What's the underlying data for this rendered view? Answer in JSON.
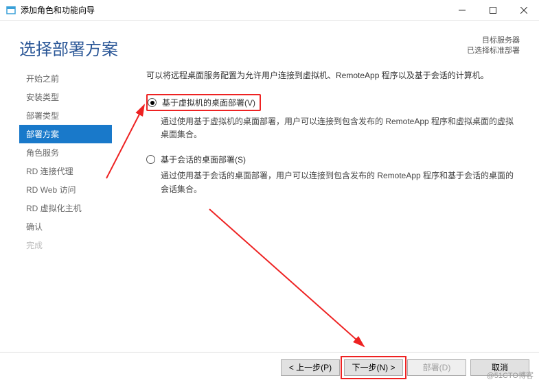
{
  "window": {
    "title": "添加角色和功能向导"
  },
  "header": {
    "heading": "选择部署方案",
    "target_label": "目标服务器",
    "target_value": "已选择标准部署"
  },
  "sidebar": {
    "items": [
      {
        "label": "开始之前",
        "state": "normal"
      },
      {
        "label": "安装类型",
        "state": "normal"
      },
      {
        "label": "部署类型",
        "state": "normal"
      },
      {
        "label": "部署方案",
        "state": "active"
      },
      {
        "label": "角色服务",
        "state": "normal"
      },
      {
        "label": "RD 连接代理",
        "state": "normal"
      },
      {
        "label": "RD Web 访问",
        "state": "normal"
      },
      {
        "label": "RD 虚拟化主机",
        "state": "normal"
      },
      {
        "label": "确认",
        "state": "normal"
      },
      {
        "label": "完成",
        "state": "disabled"
      }
    ]
  },
  "main": {
    "intro": "可以将远程桌面服务配置为允许用户连接到虚拟机、RemoteApp 程序以及基于会话的计算机。",
    "options": [
      {
        "label": "基于虚拟机的桌面部署(V)",
        "desc": "通过使用基于虚拟机的桌面部署，用户可以连接到包含发布的 RemoteApp 程序和虚拟桌面的虚拟桌面集合。",
        "checked": true,
        "highlighted": true
      },
      {
        "label": "基于会话的桌面部署(S)",
        "desc": "通过使用基于会话的桌面部署，用户可以连接到包含发布的 RemoteApp 程序和基于会话的桌面的会话集合。",
        "checked": false,
        "highlighted": false
      }
    ]
  },
  "footer": {
    "prev": "< 上一步(P)",
    "next": "下一步(N) >",
    "deploy": "部署(D)",
    "cancel": "取消"
  },
  "watermark": "@51CTO博客"
}
